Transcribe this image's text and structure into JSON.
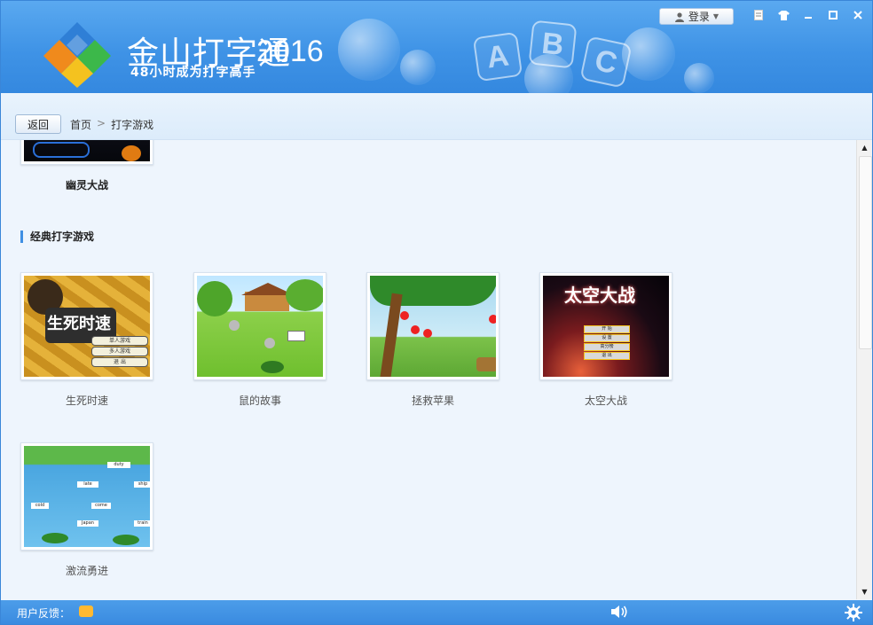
{
  "header": {
    "brand_name": "金山打字通",
    "year": "2016",
    "slogan": "48小时成为打字高手",
    "login_label": "登录",
    "decor_letters": [
      "A",
      "B",
      "C"
    ]
  },
  "nav": {
    "back_label": "返回",
    "breadcrumb": [
      "首页",
      ">",
      "打字游戏"
    ]
  },
  "content": {
    "top_game": {
      "label": "幽灵大战"
    },
    "section_title": "经典打字游戏",
    "games": [
      {
        "label": "生死时速",
        "thumb_title": "生死时速",
        "menu": [
          "单人游戏",
          "多人游戏",
          "退 出"
        ]
      },
      {
        "label": "鼠的故事"
      },
      {
        "label": "拯救苹果"
      },
      {
        "label": "太空大战",
        "thumb_title": "太空大战",
        "menu": [
          "开 始",
          "设 置",
          "高分榜",
          "退 出"
        ]
      },
      {
        "label": "激流勇进",
        "words": [
          "duty",
          "late",
          "ship",
          "cold",
          "come",
          "Japan",
          "train"
        ]
      }
    ]
  },
  "statusbar": {
    "feedback_label": "用户反馈："
  },
  "colors": {
    "header_blue": "#3f93e6",
    "accent": "#3f8fe3",
    "status_blue": "#3a8be0"
  }
}
